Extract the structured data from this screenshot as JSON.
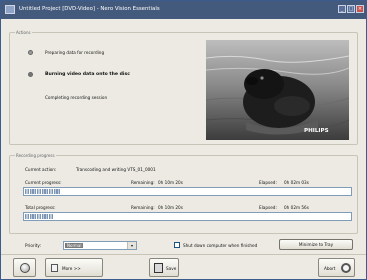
{
  "window": {
    "title": "Untitled Project [DVD-Video] - Nero Vision Essentials",
    "buttons": {
      "minimize": "_",
      "maximize": "□",
      "close": "×"
    }
  },
  "actions": {
    "group_title": "Actions",
    "steps": [
      {
        "label": "Preparing data for recording",
        "state": "done"
      },
      {
        "label": "Burning video data onto the disc",
        "state": "active"
      },
      {
        "label": "Completing recording session",
        "state": "pending"
      }
    ],
    "preview_watermark": "PHILIPS"
  },
  "progress": {
    "group_title": "Recording progress",
    "current_action_label": "Current action:",
    "current_action_value": "Transcoding and writing VTS_01_0001",
    "current": {
      "label": "Current progress:",
      "remaining_label": "Remaining:",
      "remaining_value": "0h 10m 20s",
      "elapsed_label": "Elapsed:",
      "elapsed_value": "0h 02m 03s",
      "fraction": 0.11
    },
    "total": {
      "label": "Total progress:",
      "remaining_label": "Remaining:",
      "remaining_value": "0h 10m 20s",
      "elapsed_label": "Elapsed:",
      "elapsed_value": "0h 02m 56s",
      "fraction": 0.09
    }
  },
  "options": {
    "priority_label": "Priority:",
    "priority_value": "Normal",
    "shutdown_label": "Shut down computer when finished",
    "shutdown_checked": false,
    "minimize_button": "Minimize to Tray"
  },
  "footer": {
    "more_label": "More >>",
    "save_label": "Save",
    "abort_label": "Abort"
  }
}
